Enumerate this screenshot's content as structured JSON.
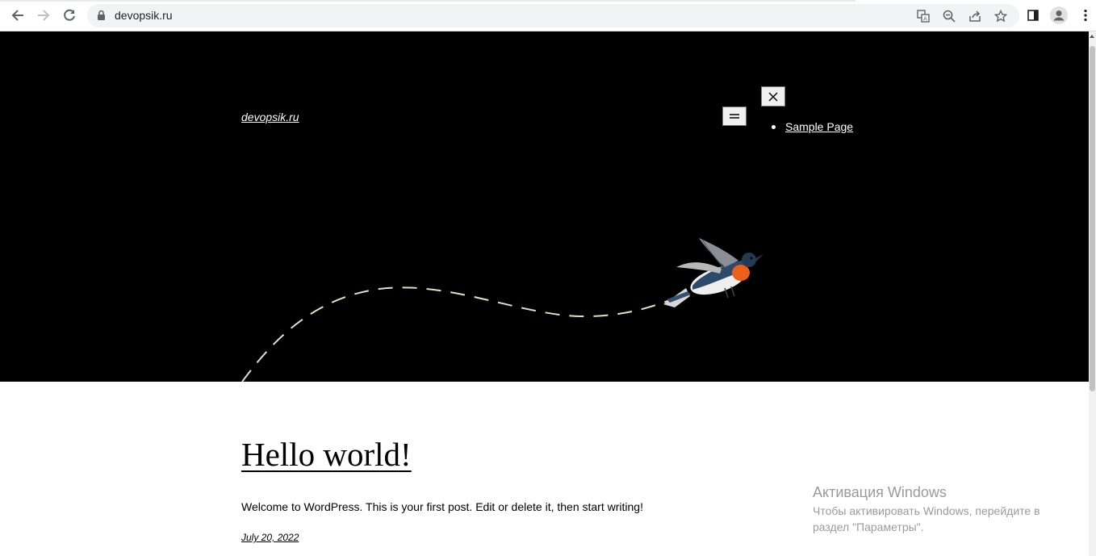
{
  "browser": {
    "url": "devopsik.ru",
    "icons": [
      "back-icon",
      "forward-icon",
      "reload-icon",
      "lock-icon",
      "translate-icon",
      "zoom-icon",
      "share-icon",
      "star-icon",
      "side-panel-icon",
      "profile-icon",
      "menu-dots-icon"
    ]
  },
  "site": {
    "title": "devopsik.ru",
    "menu_open_symbol": "=",
    "menu_close_symbol": "✕",
    "nav_items": [
      {
        "label": "Sample Page"
      }
    ]
  },
  "post": {
    "title": "Hello world!",
    "excerpt": "Welcome to WordPress. This is your first post. Edit or delete it, then start writing!",
    "date": "July 20, 2022"
  },
  "watermark": {
    "title": "Активация Windows",
    "text": "Чтобы активировать Windows, перейдите в раздел \"Параметры\"."
  },
  "colors": {
    "hero_bg": "#000000",
    "path_dash": "#e8dcc4",
    "bird_breast": "#e8601a",
    "bird_back": "#2c4a6b"
  }
}
